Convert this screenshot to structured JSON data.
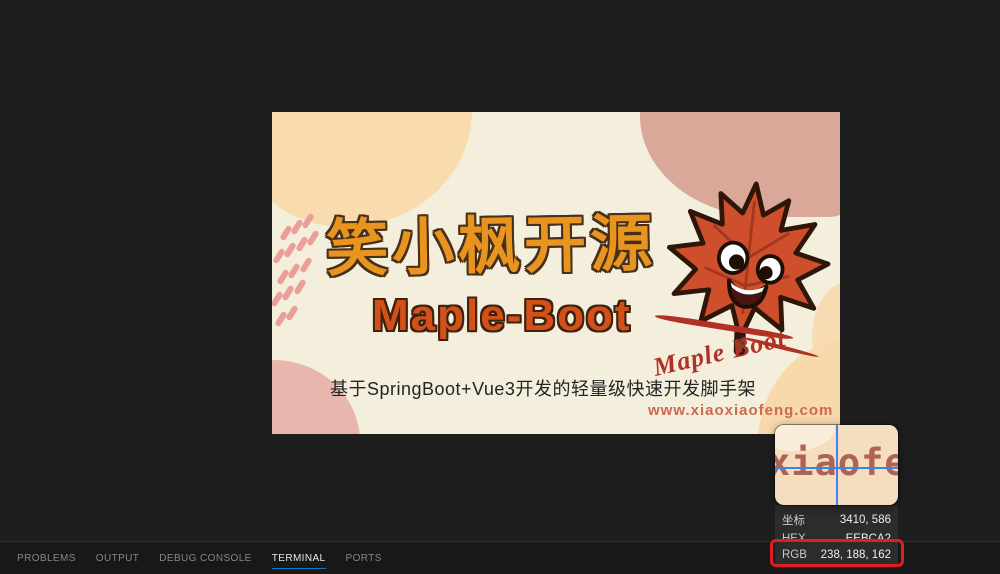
{
  "banner": {
    "title": "笑小枫开源",
    "subtitle": "Maple-Boot",
    "badge": "Maple Boot",
    "tagline": "基于SpringBoot+Vue3开发的轻量级快速开发脚手架",
    "website": "www.xiaoxiaofeng.com"
  },
  "picker": {
    "magnified_text": "xiaofe",
    "rows": [
      {
        "label": "坐标",
        "value": "3410, 586"
      },
      {
        "label": "HEX",
        "value": "EEBCA2"
      },
      {
        "label": "RGB",
        "value": "238, 188, 162"
      }
    ],
    "highlighted_row": "RGB"
  },
  "panel": {
    "tabs": [
      {
        "label": "PROBLEMS"
      },
      {
        "label": "OUTPUT"
      },
      {
        "label": "DEBUG CONSOLE"
      },
      {
        "label": "TERMINAL"
      },
      {
        "label": "PORTS"
      }
    ],
    "active_tab": "TERMINAL"
  },
  "colors": {
    "picked_hex": "#EEBCA2",
    "annotation_red": "#e11d1d",
    "crosshair_blue": "#3b82f6",
    "active_tab_underline": "#0078d4",
    "title_orange": "#e8941f",
    "subtitle_orange": "#d35019"
  }
}
